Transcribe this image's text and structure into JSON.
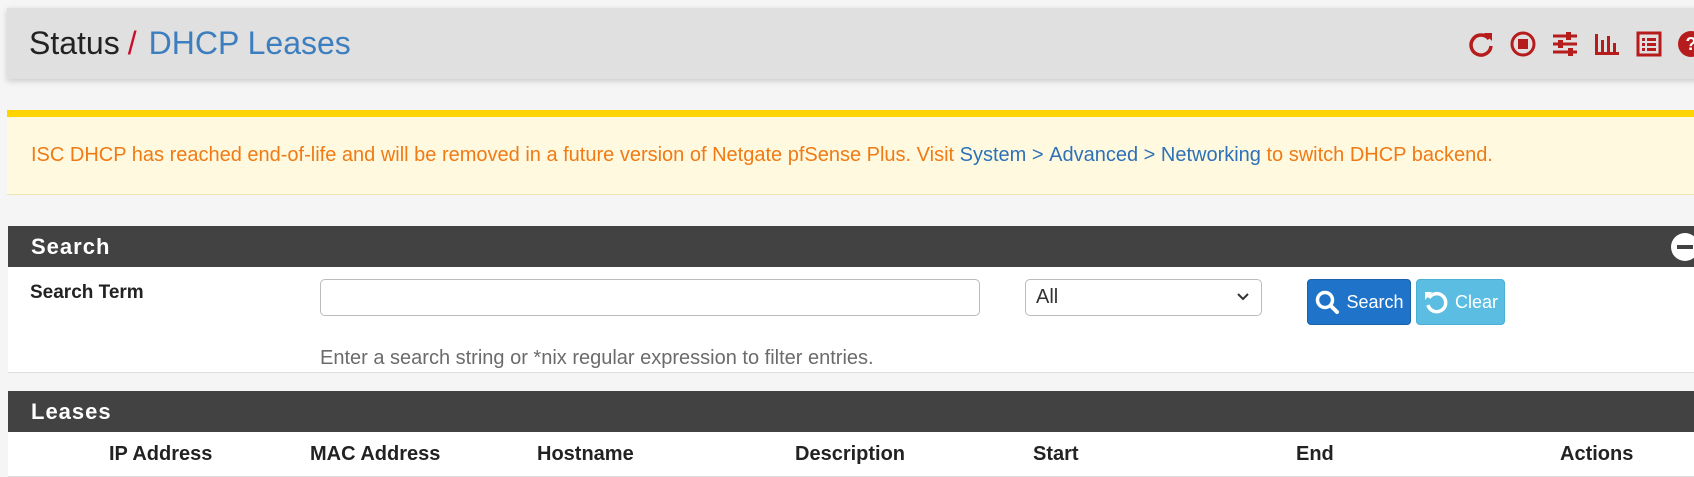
{
  "breadcrumb": {
    "parent": "Status",
    "separator": "/",
    "current": "DHCP Leases"
  },
  "header_icons": [
    "reload-icon",
    "stop-icon",
    "sliders-icon",
    "bar-chart-icon",
    "list-icon",
    "help-icon"
  ],
  "alert": {
    "text_before": "ISC DHCP has reached end-of-life and will be removed in a future version of Netgate pfSense Plus. Visit ",
    "link1": "System",
    "sep1": " > ",
    "link2": "Advanced",
    "sep2": " > ",
    "link3": "Networking",
    "text_after": " to switch DHCP backend."
  },
  "search_panel": {
    "title": "Search",
    "label": "Search Term",
    "input_value": "",
    "input_placeholder": "",
    "select_value": "All",
    "search_button": "Search",
    "clear_button": "Clear",
    "help": "Enter a search string or *nix regular expression to filter entries."
  },
  "leases_panel": {
    "title": "Leases",
    "columns": [
      "IP Address",
      "MAC Address",
      "Hostname",
      "Description",
      "Start",
      "End",
      "Actions"
    ]
  },
  "colors": {
    "header_bg": "#e0e0e0",
    "breadcrumb_sep": "#c8102e",
    "breadcrumb_link": "#3d7ebf",
    "icon_red": "#b71c1c",
    "alert_bg": "#fff9e0",
    "alert_border": "#ffd400",
    "alert_text": "#f07a14",
    "panel_heading": "#424242",
    "btn_primary": "#1f74c9",
    "btn_info": "#5cbde2"
  }
}
